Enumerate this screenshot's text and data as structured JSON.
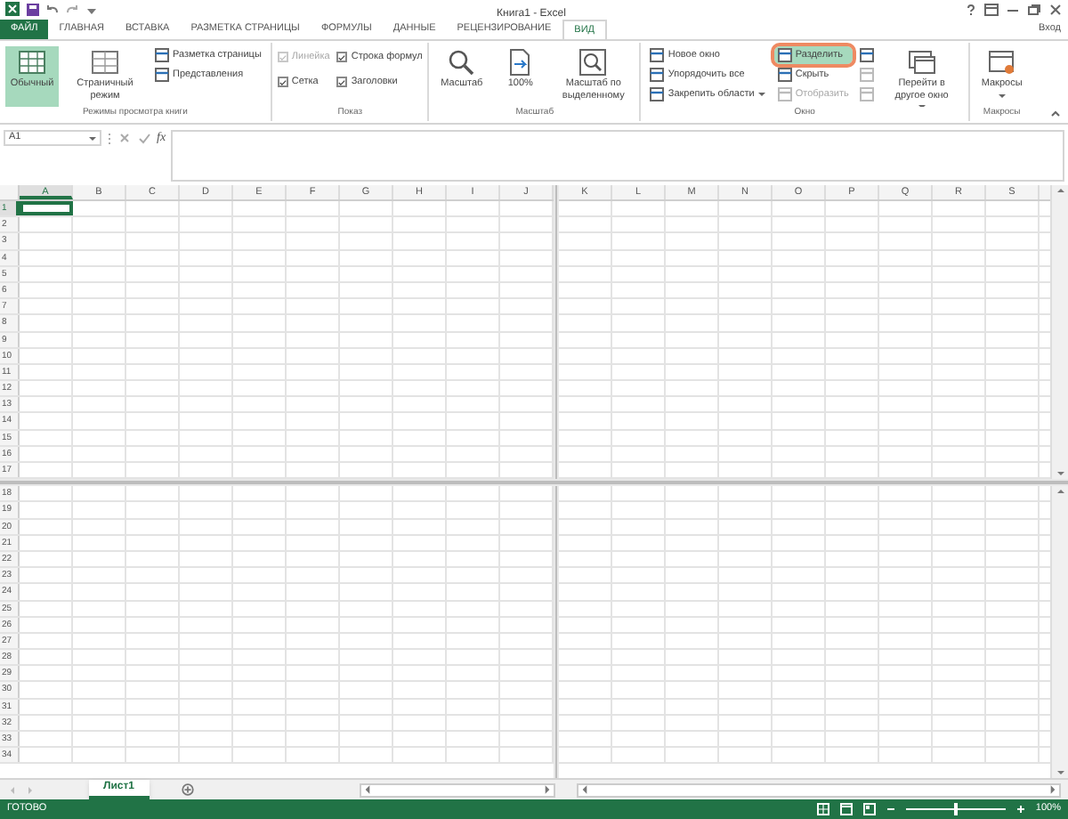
{
  "title_bar": {
    "title": "Книга1 - Excel"
  },
  "tabs": [
    {
      "label": "ФАЙЛ",
      "kind": "file",
      "selected": false
    },
    {
      "label": "ГЛАВНАЯ",
      "kind": "tab",
      "selected": false
    },
    {
      "label": "ВСТАВКА",
      "kind": "tab",
      "selected": false
    },
    {
      "label": "РАЗМЕТКА СТРАНИЦЫ",
      "kind": "tab",
      "selected": false
    },
    {
      "label": "ФОРМУЛЫ",
      "kind": "tab",
      "selected": false
    },
    {
      "label": "ДАННЫЕ",
      "kind": "tab",
      "selected": false
    },
    {
      "label": "РЕЦЕНЗИРОВАНИЕ",
      "kind": "tab",
      "selected": false
    },
    {
      "label": "ВИД",
      "kind": "tab",
      "selected": true
    }
  ],
  "account": "Вход",
  "ribbon": {
    "groups": [
      {
        "label": "Режимы просмотра книги",
        "items": [
          {
            "kind": "large",
            "label": "Обычный",
            "selected": true
          },
          {
            "kind": "large",
            "label": "Страничный режим",
            "selected": false
          },
          {
            "kind": "small",
            "label": "Разметка страницы",
            "selected": false
          },
          {
            "kind": "small",
            "label": "Представления",
            "selected": false
          }
        ]
      },
      {
        "label": "Показ",
        "items": [
          {
            "kind": "checkbox",
            "label": "Линейка",
            "checked": true,
            "disabled": true
          },
          {
            "kind": "checkbox",
            "label": "Строка формул",
            "checked": true,
            "disabled": false
          },
          {
            "kind": "checkbox",
            "label": "Сетка",
            "checked": true,
            "disabled": false
          },
          {
            "kind": "checkbox",
            "label": "Заголовки",
            "checked": true,
            "disabled": false
          }
        ]
      },
      {
        "label": "Масштаб",
        "items": [
          {
            "kind": "large",
            "label": "Масштаб",
            "menu": false
          },
          {
            "kind": "large",
            "label": "100%",
            "menu": false
          },
          {
            "kind": "large",
            "label": "Масштаб по выделенному",
            "menu": false
          }
        ]
      },
      {
        "label": "Окно",
        "items": [
          {
            "kind": "small",
            "label": "Новое окно",
            "menu": false
          },
          {
            "kind": "small",
            "label": "Упорядочить все",
            "menu": false
          },
          {
            "kind": "small",
            "label": "Закрепить области",
            "menu": true
          },
          {
            "kind": "small",
            "label": "Разделить",
            "selected": true,
            "highlighted": true
          },
          {
            "kind": "small",
            "label": "Скрыть",
            "disabled": false
          },
          {
            "kind": "small",
            "label": "Отобразить",
            "disabled": true
          },
          {
            "kind": "icon",
            "disabled": false
          },
          {
            "kind": "icon",
            "disabled": true
          },
          {
            "kind": "icon",
            "disabled": true
          },
          {
            "kind": "large",
            "label": "Перейти в другое окно",
            "menu": true
          }
        ]
      },
      {
        "label": "Макросы",
        "items": [
          {
            "kind": "large",
            "label": "Макросы",
            "menu": true
          }
        ]
      }
    ]
  },
  "formula_bar": {
    "name_box": "A1",
    "function_label": "fx"
  },
  "sheet": {
    "left_columns": [
      {
        "label": "A",
        "selected": true
      },
      {
        "label": "B",
        "selected": false
      },
      {
        "label": "C",
        "selected": false
      },
      {
        "label": "D",
        "selected": false
      },
      {
        "label": "E",
        "selected": false
      },
      {
        "label": "F",
        "selected": false
      },
      {
        "label": "G",
        "selected": false
      },
      {
        "label": "H",
        "selected": false
      },
      {
        "label": "I",
        "selected": false
      },
      {
        "label": "J",
        "selected": false
      }
    ],
    "right_columns": [
      {
        "label": "K",
        "selected": false
      },
      {
        "label": "L",
        "selected": false
      },
      {
        "label": "M",
        "selected": false
      },
      {
        "label": "N",
        "selected": false
      },
      {
        "label": "O",
        "selected": false
      },
      {
        "label": "P",
        "selected": false
      },
      {
        "label": "Q",
        "selected": false
      },
      {
        "label": "R",
        "selected": false
      },
      {
        "label": "S",
        "selected": false
      }
    ],
    "top_rows": [
      {
        "label": "1",
        "selected": true
      },
      {
        "label": "2",
        "selected": false
      },
      {
        "label": "3",
        "selected": false
      },
      {
        "label": "4",
        "selected": false
      },
      {
        "label": "5",
        "selected": false
      },
      {
        "label": "6",
        "selected": false
      },
      {
        "label": "7",
        "selected": false
      },
      {
        "label": "8",
        "selected": false
      },
      {
        "label": "9",
        "selected": false
      },
      {
        "label": "10",
        "selected": false
      },
      {
        "label": "11",
        "selected": false
      },
      {
        "label": "12",
        "selected": false
      },
      {
        "label": "13",
        "selected": false
      },
      {
        "label": "14",
        "selected": false
      },
      {
        "label": "15",
        "selected": false
      },
      {
        "label": "16",
        "selected": false
      },
      {
        "label": "17",
        "selected": false
      }
    ],
    "bottom_rows": [
      {
        "label": "18",
        "selected": false
      },
      {
        "label": "19",
        "selected": false
      },
      {
        "label": "20",
        "selected": false
      },
      {
        "label": "21",
        "selected": false
      },
      {
        "label": "22",
        "selected": false
      },
      {
        "label": "23",
        "selected": false
      },
      {
        "label": "24",
        "selected": false
      },
      {
        "label": "25",
        "selected": false
      },
      {
        "label": "26",
        "selected": false
      },
      {
        "label": "27",
        "selected": false
      },
      {
        "label": "28",
        "selected": false
      },
      {
        "label": "29",
        "selected": false
      },
      {
        "label": "30",
        "selected": false
      },
      {
        "label": "31",
        "selected": false
      },
      {
        "label": "32",
        "selected": false
      },
      {
        "label": "33",
        "selected": false
      },
      {
        "label": "34",
        "selected": false
      }
    ]
  },
  "sheet_tabs": [
    {
      "label": "Лист1",
      "selected": true
    }
  ],
  "status_bar": {
    "status": "ГОТОВО",
    "zoom": {
      "level": 0.5,
      "reading": "100%"
    }
  }
}
